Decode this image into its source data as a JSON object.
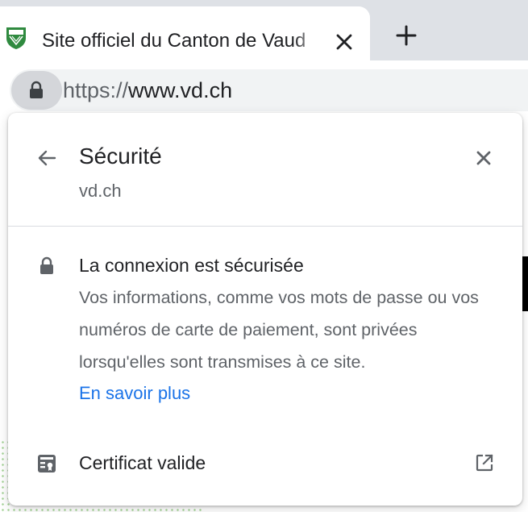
{
  "tab": {
    "title": "Site officiel du Canton de Vaud"
  },
  "omnibox": {
    "url_scheme": "https://",
    "url_host": "www.vd.ch"
  },
  "popup": {
    "title": "Sécurité",
    "domain": "vd.ch",
    "connection_title": "La connexion est sécurisée",
    "connection_description": "Vos informations, comme vos mots de passe ou vos numéros de carte de paiement, sont privées lorsqu'elles sont transmises à ce site.",
    "learn_more": "En savoir plus",
    "certificate_label": "Certificat valide"
  },
  "icons": {
    "favicon": "vaud-shield-icon",
    "tab_close": "close-icon",
    "new_tab": "plus-icon",
    "site_info": "lock-icon",
    "back": "arrow-left-icon",
    "popup_close": "close-icon",
    "secure": "lock-icon",
    "certificate": "certificate-icon",
    "external": "external-link-icon"
  },
  "colors": {
    "link": "#1a73e8",
    "text_primary": "#202124",
    "text_secondary": "#5f6368",
    "tab_strip": "#dee1e6",
    "favicon_green": "#2f8a3f"
  }
}
